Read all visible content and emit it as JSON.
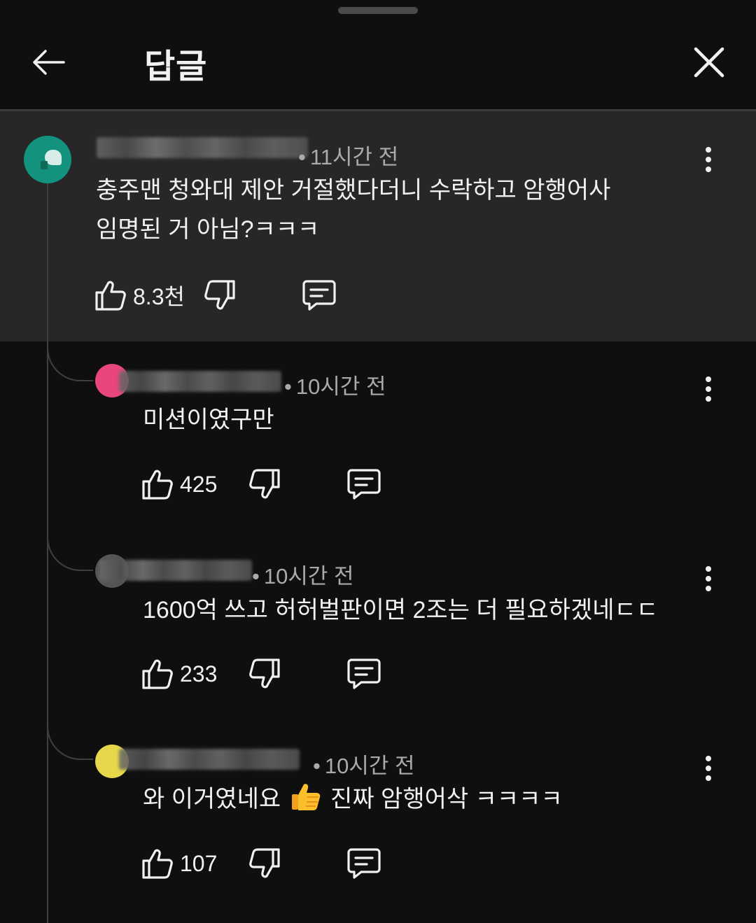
{
  "header": {
    "title": "답글"
  },
  "parent_comment": {
    "time": "11시간 전",
    "text_line1": "충주맨 청와대 제안 거절했다더니 수락하고 암행어사",
    "text_line2": "임명된 거 아님?ㅋㅋㅋ",
    "likes": "8.3천"
  },
  "replies": [
    {
      "time": "10시간 전",
      "text": "미션이였구만",
      "likes": "425",
      "avatar_color": "#e8467c"
    },
    {
      "time": "10시간 전",
      "text": "1600억 쓰고 허허벌판이면 2조는 더 필요하겠네ㄷㄷ",
      "likes": "233",
      "avatar_color": "#555555"
    },
    {
      "time": "10시간 전",
      "text_before_emoji": "와 이거였네요",
      "text_after_emoji": "진짜 암행어삭 ㅋㅋㅋㅋ",
      "likes": "107",
      "avatar_color": "#e6d84a"
    }
  ],
  "icons": {
    "back": "arrow-left-icon",
    "close": "close-icon",
    "more": "more-vertical-icon",
    "like": "thumb-up-icon",
    "dislike": "thumb-down-icon",
    "reply": "comment-icon",
    "emoji": "thumbs-up-emoji"
  },
  "colors": {
    "background": "#0f0f0f",
    "highlight": "#272727",
    "text": "#f1f1f1",
    "meta": "#aaaaaa"
  }
}
